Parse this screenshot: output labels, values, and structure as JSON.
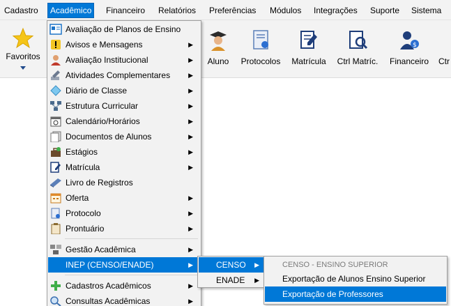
{
  "menubar": {
    "items": [
      {
        "label": "Cadastro"
      },
      {
        "label": "Acadêmico"
      },
      {
        "label": "Financeiro"
      },
      {
        "label": "Relatórios"
      },
      {
        "label": "Preferências"
      },
      {
        "label": "Módulos"
      },
      {
        "label": "Integrações"
      },
      {
        "label": "Suporte"
      },
      {
        "label": "Sistema"
      }
    ]
  },
  "toolbar": {
    "favoritos": "Favoritos",
    "buttons": [
      {
        "label": "Aluno",
        "icon": "student-icon"
      },
      {
        "label": "Protocolos",
        "icon": "certificate-icon"
      },
      {
        "label": "Matrícula",
        "icon": "form-edit-icon"
      },
      {
        "label": "Ctrl Matríc.",
        "icon": "document-search-icon"
      },
      {
        "label": "Financeiro",
        "icon": "person-money-icon"
      },
      {
        "label": "Ctr"
      }
    ]
  },
  "academico_menu": {
    "items": [
      {
        "label": "Avaliação de Planos de Ensino",
        "icon": "plan-icon",
        "submenu": false
      },
      {
        "label": "Avisos e Mensagens",
        "icon": "warning-icon",
        "submenu": true
      },
      {
        "label": "Avaliação Institucional",
        "icon": "institutional-icon",
        "submenu": true
      },
      {
        "label": "Atividades Complementares",
        "icon": "pencil-icon",
        "submenu": true
      },
      {
        "label": "Diário de Classe",
        "icon": "diamond-icon",
        "submenu": true
      },
      {
        "label": "Estrutura Curricular",
        "icon": "structure-icon",
        "submenu": true
      },
      {
        "label": "Calendário/Horários",
        "icon": "calendar-icon",
        "submenu": true
      },
      {
        "label": "Documentos de Alunos",
        "icon": "documents-icon",
        "submenu": true
      },
      {
        "label": "Estágios",
        "icon": "internship-icon",
        "submenu": true
      },
      {
        "label": "Matrícula",
        "icon": "form-edit-icon",
        "submenu": true
      },
      {
        "label": "Livro de Registros",
        "icon": "book-icon",
        "submenu": false
      },
      {
        "label": "Oferta",
        "icon": "offer-icon",
        "submenu": true
      },
      {
        "label": "Protocolo",
        "icon": "protocol-icon",
        "submenu": true
      },
      {
        "label": "Prontuário",
        "icon": "clipboard-icon",
        "submenu": true
      },
      {
        "label": "Gestão Acadêmica",
        "icon": "management-icon",
        "submenu": true
      },
      {
        "label": "INEP (CENSO/ENADE)",
        "icon": "",
        "submenu": true
      },
      {
        "label": "Cadastros Acadêmicos",
        "icon": "plus-icon",
        "submenu": true
      },
      {
        "label": "Consultas Acadêmicas",
        "icon": "search-icon",
        "submenu": true
      }
    ]
  },
  "inep_menu": {
    "items": [
      {
        "label": "CENSO"
      },
      {
        "label": "ENADE"
      }
    ]
  },
  "censo_menu": {
    "header": "CENSO - ENSINO SUPERIOR",
    "items": [
      {
        "label": "Exportação de Alunos Ensino Superior"
      },
      {
        "label": "Exportação de Professores"
      }
    ]
  },
  "colors": {
    "highlight": "#0078d7",
    "menu_bg": "#f2f2f2",
    "toolbar_bg": "#f3f3f3"
  }
}
